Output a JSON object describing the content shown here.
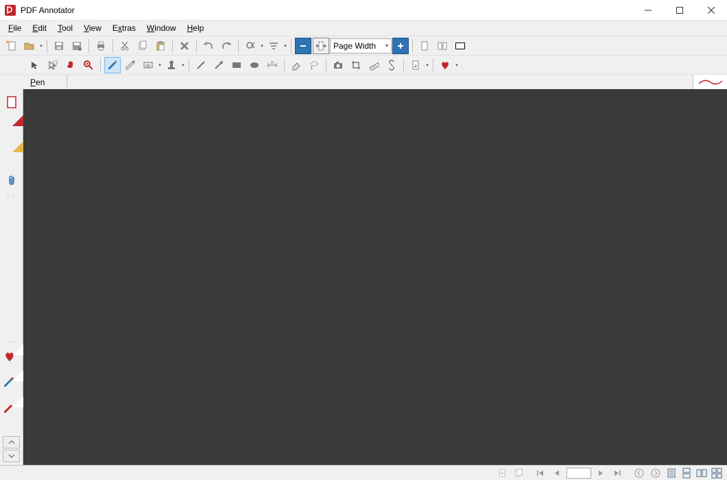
{
  "window": {
    "title": "PDF Annotator"
  },
  "menu": {
    "file": "File",
    "edit": "Edit",
    "tool": "Tool",
    "view": "View",
    "extras": "Extras",
    "window": "Window",
    "help": "Help"
  },
  "toolbar1": {
    "zoom_value": "Page Width"
  },
  "toolrow": {
    "label": "Pen"
  },
  "colors": {
    "accent_red": "#c1272d",
    "accent_blue": "#2e74b5",
    "canvas": "#3a3a3a"
  }
}
